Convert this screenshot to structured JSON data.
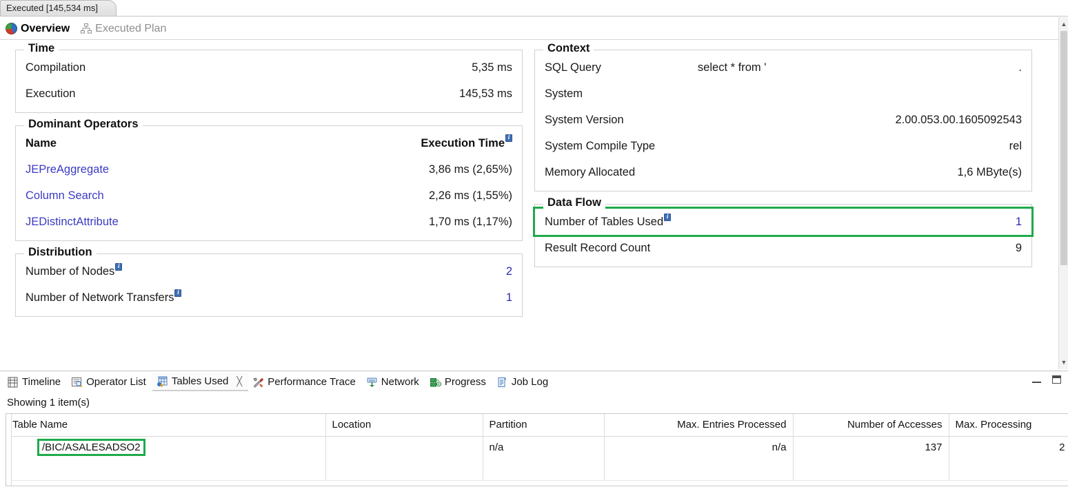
{
  "editor_tab": {
    "label": "Executed [145,534 ms]"
  },
  "view_tabs": {
    "overview": "Overview",
    "executed_plan": "Executed Plan"
  },
  "overview": {
    "time": {
      "title": "Time",
      "rows": [
        {
          "label": "Compilation",
          "value": "5,35 ms"
        },
        {
          "label": "Execution",
          "value": "145,53 ms"
        }
      ]
    },
    "dominant_operators": {
      "title": "Dominant Operators",
      "header": {
        "name": "Name",
        "execution_time": "Execution Time"
      },
      "rows": [
        {
          "name": "JEPreAggregate",
          "time": "3,86 ms (2,65%)"
        },
        {
          "name": "Column Search",
          "time": "2,26 ms (1,55%)"
        },
        {
          "name": "JEDistinctAttribute",
          "time": "1,70 ms (1,17%)"
        }
      ]
    },
    "distribution": {
      "title": "Distribution",
      "rows": [
        {
          "label": "Number of Nodes",
          "value": "2",
          "info": true
        },
        {
          "label": "Number of Network Transfers",
          "value": "1",
          "info": true
        }
      ]
    },
    "context": {
      "title": "Context",
      "rows": [
        {
          "label": "SQL Query",
          "value": "select * from '",
          "value_trail": "."
        },
        {
          "label": "System",
          "value": ""
        },
        {
          "label": "System Version",
          "value": "2.00.053.00.1605092543"
        },
        {
          "label": "System Compile Type",
          "value": "rel"
        },
        {
          "label": "Memory Allocated",
          "value": "1,6 MByte(s)"
        }
      ]
    },
    "data_flow": {
      "title": "Data Flow",
      "rows": [
        {
          "label": "Number of Tables Used",
          "value": "1",
          "info": true,
          "highlighted": true
        },
        {
          "label": "Result Record Count",
          "value": "9",
          "info": false,
          "highlighted": false
        }
      ]
    }
  },
  "bottom_tabs": [
    {
      "label": "Timeline",
      "icon": "timeline-icon",
      "active": false,
      "closable": false
    },
    {
      "label": "Operator List",
      "icon": "operator-list-icon",
      "active": false,
      "closable": false
    },
    {
      "label": "Tables Used",
      "icon": "tables-used-icon",
      "active": true,
      "closable": true,
      "close_glyph": "╳"
    },
    {
      "label": "Performance Trace",
      "icon": "performance-trace-icon",
      "active": false,
      "closable": false
    },
    {
      "label": "Network",
      "icon": "network-icon",
      "active": false,
      "closable": false
    },
    {
      "label": "Progress",
      "icon": "progress-icon",
      "active": false,
      "closable": false
    },
    {
      "label": "Job Log",
      "icon": "job-log-icon",
      "active": false,
      "closable": false
    }
  ],
  "tables_used": {
    "status": "Showing 1 item(s)",
    "columns": [
      "Table Name",
      "Location",
      "Partition",
      "Max. Entries Processed",
      "Number of Accesses",
      "Max. Processing"
    ],
    "rows": [
      {
        "table_name": "/BIC/ASALESADSO2",
        "location": "",
        "partition": "n/a",
        "max_entries_processed": "n/a",
        "number_of_accesses": "137",
        "max_processing": "2",
        "highlighted": true
      }
    ]
  },
  "colors": {
    "link": "#3b3bc4",
    "number": "#2a2ab0",
    "highlight": "#1faa4b",
    "info_badge": "#3f6fb5"
  }
}
